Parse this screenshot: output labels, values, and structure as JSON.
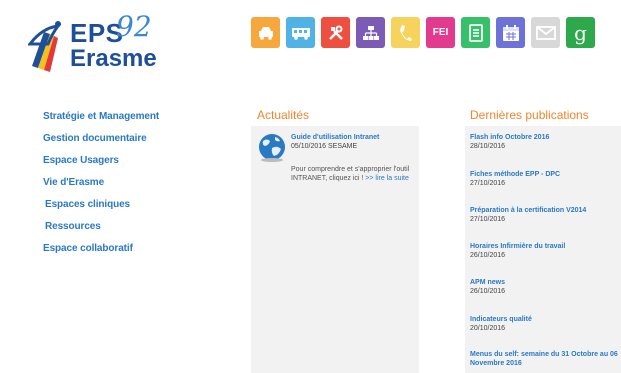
{
  "logo": {
    "eps": "EPS",
    "number": "92",
    "name": "Erasme"
  },
  "toolbar": [
    {
      "icon": "car-icon",
      "color": "#f6a83c"
    },
    {
      "icon": "bus-icon",
      "color": "#4fb3e6"
    },
    {
      "icon": "tools-icon",
      "color": "#ef4f3f"
    },
    {
      "icon": "org-chart-icon",
      "color": "#7b5bb5"
    },
    {
      "icon": "phone-icon",
      "color": "#f5d35c"
    },
    {
      "icon": "fei-icon",
      "label": "FEI",
      "color": "#e23a8f"
    },
    {
      "icon": "document-icon",
      "color": "#36c06a"
    },
    {
      "icon": "calendar-icon",
      "color": "#6c72d8"
    },
    {
      "icon": "mail-icon",
      "color": "#d8d8d8"
    },
    {
      "icon": "google-icon",
      "label": "g",
      "color": "#2da84a"
    }
  ],
  "nav": [
    {
      "label": "Stratégie et Management"
    },
    {
      "label": "Gestion documentaire"
    },
    {
      "label": "Espace Usagers"
    },
    {
      "label": "Vie d'Erasme"
    },
    {
      "label": "Espaces cliniques"
    },
    {
      "label": "Ressources"
    },
    {
      "label": "Espace collaboratif"
    }
  ],
  "news": {
    "heading": "Actualités",
    "item": {
      "title": "Guide d'utilisation Intranet",
      "date": "05/10/2016 SESAME",
      "desc": "Pour comprendre et s'approprier l'outil INTRANET, cliquez ici ! ",
      "more": ">> lire la suite"
    }
  },
  "publications": {
    "heading": "Dernières publications",
    "items": [
      {
        "title": "Flash info Octobre 2016",
        "date": "28/10/2016"
      },
      {
        "title": "Fiches méthode EPP - DPC",
        "date": "27/10/2016"
      },
      {
        "title": "Préparation à la certification V2014",
        "date": "27/10/2016"
      },
      {
        "title": "Horaires Infirmière du travail",
        "date": "26/10/2016"
      },
      {
        "title": "APM news",
        "date": "26/10/2016"
      },
      {
        "title": "Indicateurs qualité",
        "date": "20/10/2016"
      },
      {
        "title": "Menus du self: semaine du 31 Octobre au 06 Novembre 2016",
        "date": ""
      }
    ]
  }
}
